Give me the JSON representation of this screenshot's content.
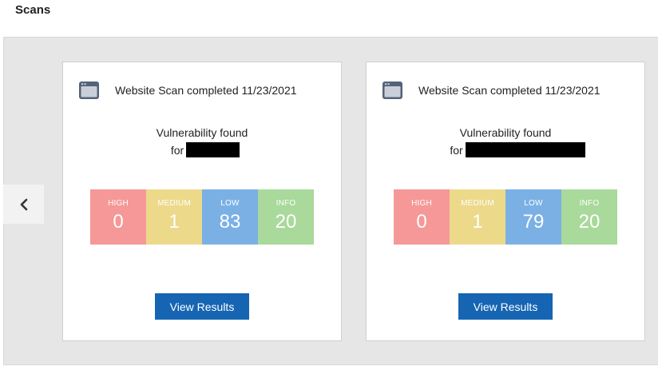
{
  "page": {
    "title": "Scans"
  },
  "carousel": {
    "prev_icon": "chevron-left-icon"
  },
  "colors": {
    "high": "#f69898",
    "medium": "#ecd98a",
    "low": "#7bb0e5",
    "info": "#a9d99b",
    "button": "#1565b3"
  },
  "cards": [
    {
      "icon": "browser-window-icon",
      "title": "Website Scan completed 11/23/2021",
      "vulnerability_label": "Vulnerability found",
      "for_label": "for",
      "severities": [
        {
          "label": "HIGH",
          "count": "0"
        },
        {
          "label": "MEDIUM",
          "count": "1"
        },
        {
          "label": "LOW",
          "count": "83"
        },
        {
          "label": "INFO",
          "count": "20"
        }
      ],
      "button_label": "View Results"
    },
    {
      "icon": "browser-window-icon",
      "title": "Website Scan completed 11/23/2021",
      "vulnerability_label": "Vulnerability found",
      "for_label": "for",
      "severities": [
        {
          "label": "HIGH",
          "count": "0"
        },
        {
          "label": "MEDIUM",
          "count": "1"
        },
        {
          "label": "LOW",
          "count": "79"
        },
        {
          "label": "INFO",
          "count": "20"
        }
      ],
      "button_label": "View Results"
    }
  ]
}
